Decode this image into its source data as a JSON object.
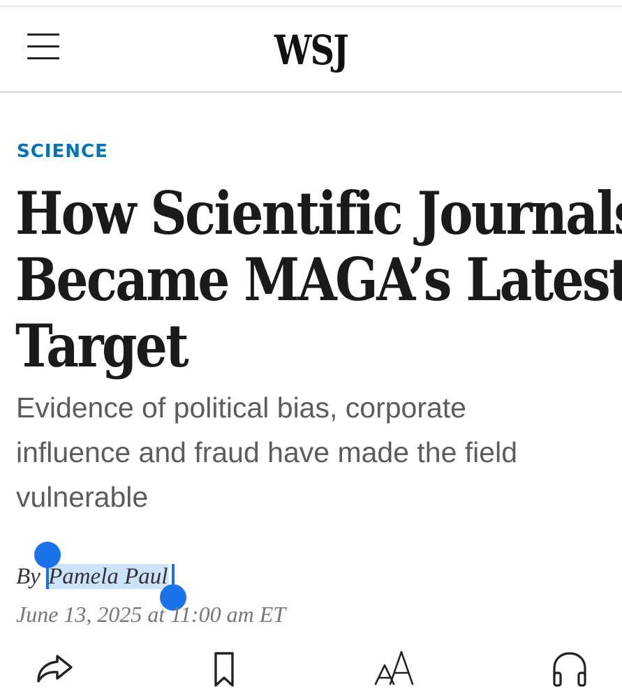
{
  "header": {
    "logo": "WSJ",
    "menu_icon": "hamburger-menu-icon"
  },
  "article": {
    "section": "SCIENCE",
    "headline_lines": [
      "How Scientific Journals",
      "Became MAGA’s Latest",
      "Target"
    ],
    "dek_lines": [
      "Evidence of political bias, corporate",
      "influence and fraud have made the field",
      "vulnerable"
    ],
    "byline_prefix": "By ",
    "author": "Pamela Paul",
    "date": "June 13, 2025 at 11:00 am ET"
  },
  "selection": {
    "selected_text": "Pamela Paul",
    "highlight_color": "#cde3fb",
    "handle_color": "#1a73e8"
  },
  "toolbar": {
    "icons": [
      "share-icon",
      "bookmark-icon",
      "text-size-icon",
      "headphones-icon"
    ]
  },
  "colors": {
    "section_accent": "#0274b6",
    "headline": "#1a1a1a",
    "dek": "#5c5c5c",
    "date": "#777777"
  }
}
